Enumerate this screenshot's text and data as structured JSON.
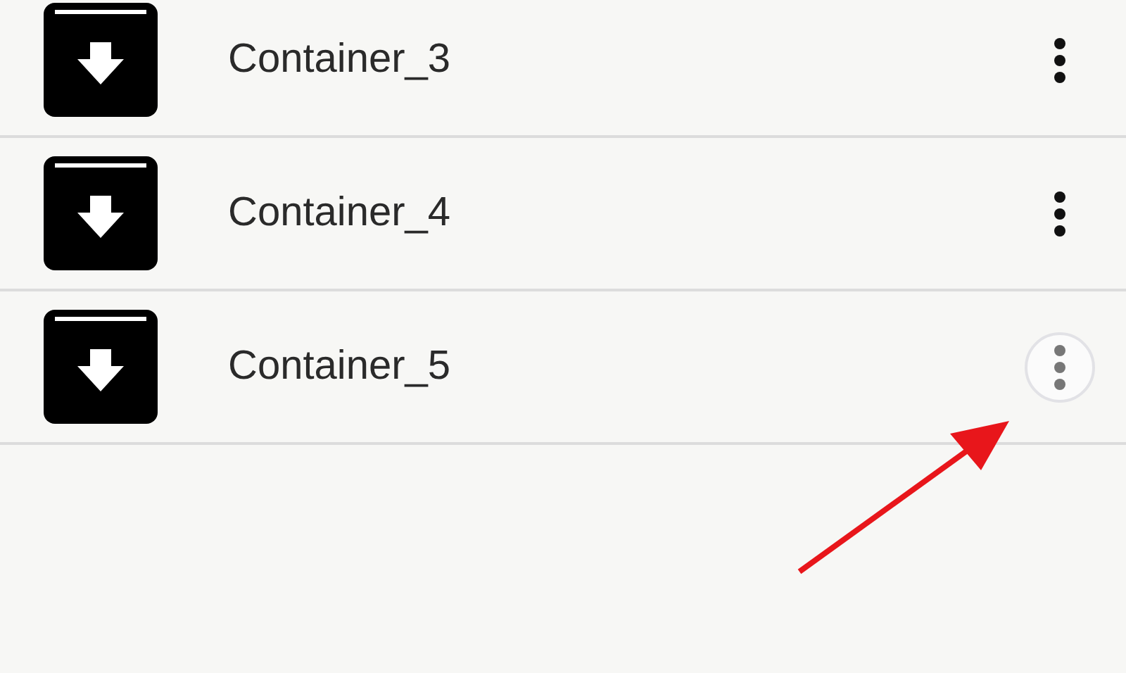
{
  "items": [
    {
      "name": "Container_3",
      "menu_pressed": false
    },
    {
      "name": "Container_4",
      "menu_pressed": false
    },
    {
      "name": "Container_5",
      "menu_pressed": true
    }
  ]
}
